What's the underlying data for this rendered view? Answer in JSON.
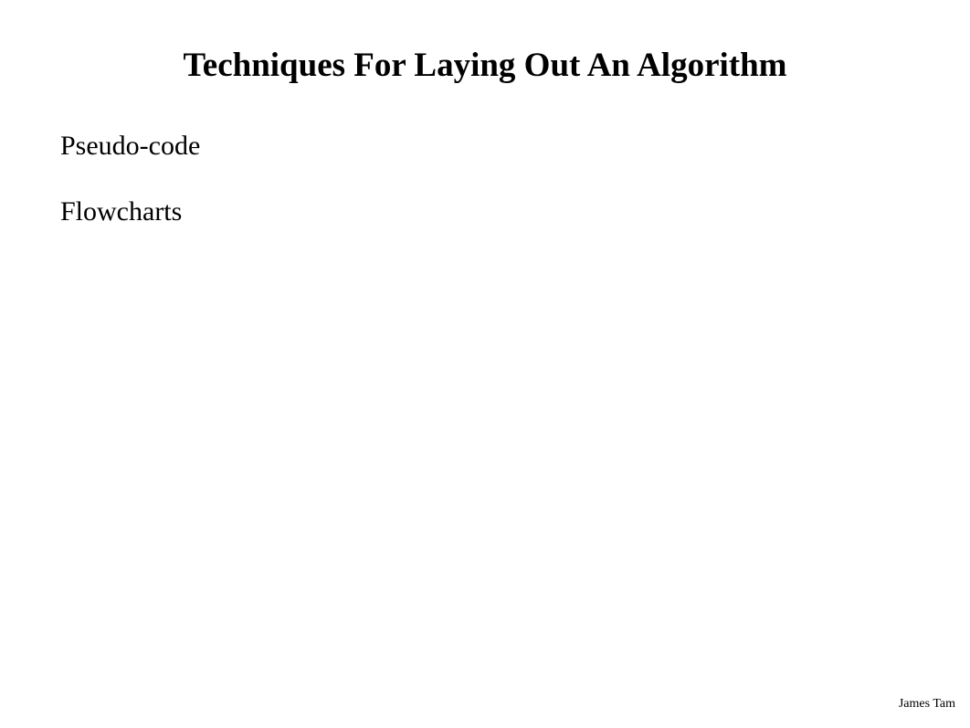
{
  "slide": {
    "title": "Techniques For Laying Out An Algorithm",
    "bullets": [
      "Pseudo-code",
      "Flowcharts"
    ],
    "footer": "James Tam"
  }
}
